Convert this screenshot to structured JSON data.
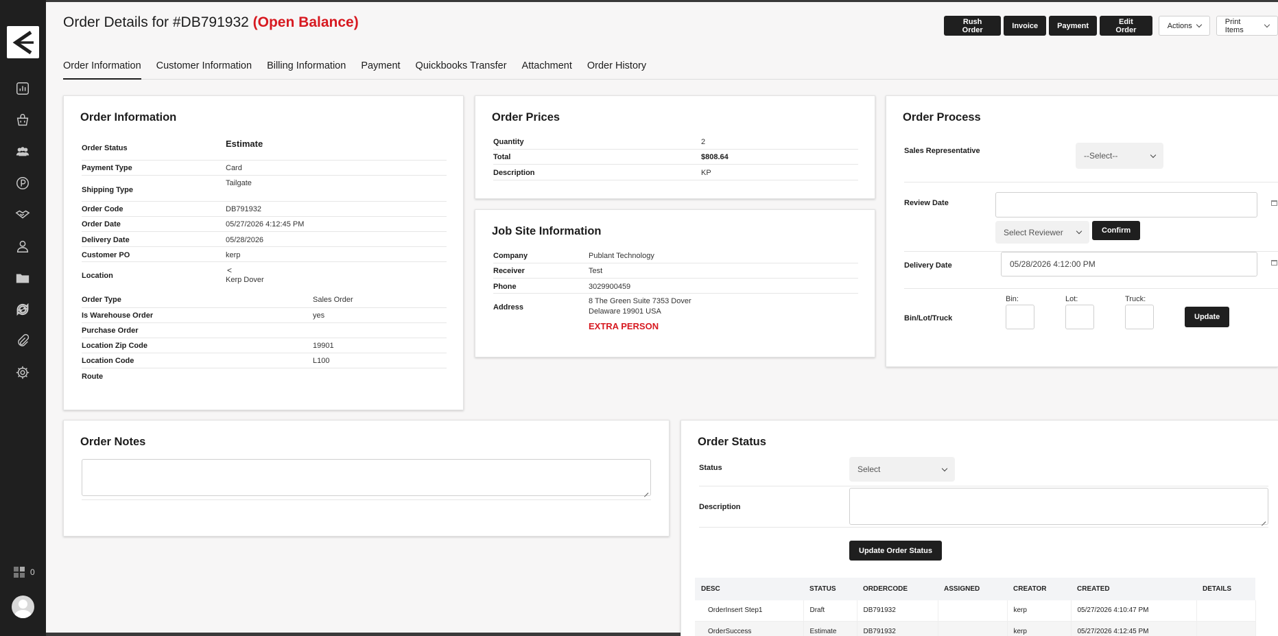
{
  "page": {
    "title_prefix": "Order Details for #DB791932",
    "title_badge": "(Open Balance)"
  },
  "actions": {
    "rush_order": "Rush Order",
    "invoice": "Invoice",
    "payment": "Payment",
    "edit_order": "Edit Order",
    "actions": "Actions",
    "print_items": "Print Items"
  },
  "tabs": [
    {
      "label": "Order Information",
      "active": true
    },
    {
      "label": "Customer Information"
    },
    {
      "label": "Billing Information"
    },
    {
      "label": "Payment"
    },
    {
      "label": "Quickbooks Transfer"
    },
    {
      "label": "Attachment"
    },
    {
      "label": "Order History"
    }
  ],
  "sidebar": {
    "icons": [
      "chart-icon",
      "basket-icon",
      "users-icon",
      "parking-icon",
      "handshake-icon",
      "user-icon",
      "folder-icon",
      "sync-icon",
      "paperclip-icon",
      "gear-icon"
    ],
    "apps_count": "0"
  },
  "order_info": {
    "title": "Order Information",
    "rows": [
      {
        "k": "Order Status",
        "v": "Estimate"
      },
      {
        "k": "Payment Type",
        "v": "Card"
      },
      {
        "k": "Shipping Type",
        "v": "Tailgate"
      },
      {
        "k": "Order Code",
        "v": "DB791932"
      },
      {
        "k": "Order Date",
        "v": "05/27/2026 4:12:45 PM"
      },
      {
        "k": "Delivery Date",
        "v": "05/28/2026"
      },
      {
        "k": "Customer PO",
        "v": "kerp"
      },
      {
        "k": "Location",
        "v_arrow": "<",
        "v": "Kerp Dover"
      },
      {
        "k": "Order Type",
        "v": "Sales Order"
      },
      {
        "k": "Is Warehouse Order",
        "v": "yes"
      },
      {
        "k": "Purchase Order",
        "v": ""
      },
      {
        "k": "Location Zip Code",
        "v": "19901"
      },
      {
        "k": "Location Code",
        "v": "L100"
      },
      {
        "k": "Route",
        "v": ""
      }
    ]
  },
  "order_prices": {
    "title": "Order Prices",
    "rows": [
      {
        "k": "Quantity",
        "v": "2"
      },
      {
        "k": "Total",
        "v": "$808.64"
      },
      {
        "k": "Description",
        "v": "KP"
      }
    ]
  },
  "job_site": {
    "title": "Job Site Information",
    "rows": [
      {
        "k": "Company",
        "v": "Publant Technology"
      },
      {
        "k": "Receiver",
        "v": "Test"
      },
      {
        "k": "Phone",
        "v": "3029900459"
      },
      {
        "k": "Address",
        "v": "8 The Green Suite 7353 Dover",
        "v2": "Delaware 19901 USA"
      }
    ],
    "extra": "EXTRA PERSON"
  },
  "order_process": {
    "title": "Order Process",
    "sales_rep_label": "Sales Representative",
    "sales_rep_value": "--Select--",
    "review_date_label": "Review Date",
    "review_date_value": "",
    "reviewer_value": "Select Reviewer",
    "confirm": "Confirm",
    "delivery_date_label": "Delivery Date",
    "delivery_date_value": "05/28/2026 4:12:00 PM",
    "bin_label": "Bin/Lot/Truck",
    "bin": "Bin:",
    "lot": "Lot:",
    "truck": "Truck:",
    "update": "Update"
  },
  "order_notes": {
    "title": "Order Notes",
    "value": ""
  },
  "order_status": {
    "title": "Order Status",
    "status_label": "Status",
    "status_value": "Select",
    "description_label": "Description",
    "update_button": "Update Order Status",
    "columns": [
      "DESC",
      "STATUS",
      "ORDERCODE",
      "ASSIGNED",
      "CREATOR",
      "CREATED",
      "DETAILS"
    ],
    "rows": [
      [
        "OrderInsert Step1",
        "Draft",
        "DB791932",
        "",
        "kerp",
        "05/27/2026 4:10:47 PM",
        ""
      ],
      [
        "OrderSuccess",
        "Estimate",
        "DB791932",
        "",
        "kerp",
        "05/27/2026 4:12:45 PM",
        ""
      ]
    ]
  }
}
